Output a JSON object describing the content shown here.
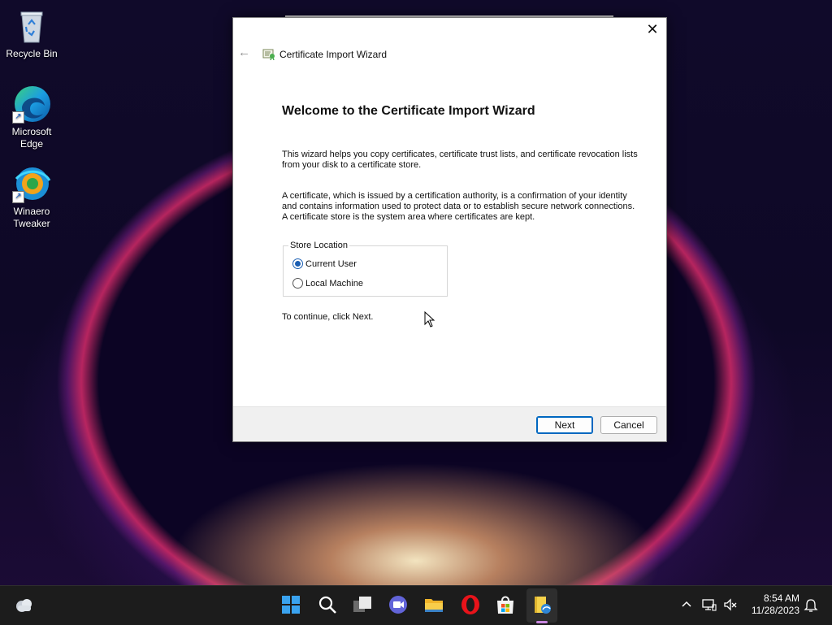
{
  "desktop": {
    "icons": [
      {
        "label": "Recycle Bin",
        "icon": "recycle-bin-icon"
      },
      {
        "label": "Microsoft\nEdge",
        "icon": "edge-icon"
      },
      {
        "label": "Winaero\nTweaker",
        "icon": "winaero-tweaker-icon"
      }
    ]
  },
  "dialog": {
    "title": "Certificate Import Wizard",
    "heading": "Welcome to the Certificate Import Wizard",
    "para1": "This wizard helps you copy certificates, certificate trust lists, and certificate revocation lists from your disk to a certificate store.",
    "para2": "A certificate, which is issued by a certification authority, is a confirmation of your identity and contains information used to protect data or to establish secure network connections. A certificate store is the system area where certificates are kept.",
    "store_location": {
      "legend": "Store Location",
      "options": [
        {
          "label": "Current User",
          "selected": true
        },
        {
          "label": "Local Machine",
          "selected": false
        }
      ]
    },
    "continue_text": "To continue, click Next.",
    "buttons": {
      "next": "Next",
      "cancel": "Cancel"
    },
    "close_symbol": "✕",
    "back_symbol": "←"
  },
  "taskbar": {
    "icons": [
      "widgets-icon",
      "start-icon",
      "search-icon",
      "task-view-icon",
      "chat-icon",
      "file-explorer-icon",
      "opera-icon",
      "store-icon",
      "certificate-manager-icon"
    ],
    "clock": {
      "time": "8:54 AM",
      "date": "11/28/2023"
    }
  },
  "colors": {
    "accent": "#0067c0",
    "radio": "#1b5fb3",
    "taskbar": "#1c1c1c"
  }
}
